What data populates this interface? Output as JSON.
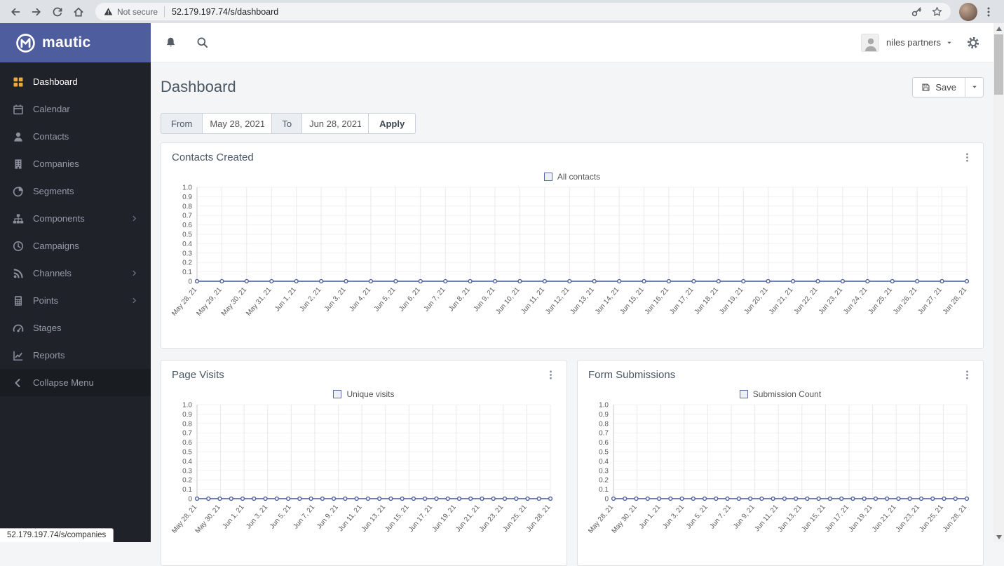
{
  "browser": {
    "security_label": "Not secure",
    "url": "52.179.197.74/s/dashboard",
    "status_bar_link": "52.179.197.74/s/companies"
  },
  "brand": {
    "name": "mautic"
  },
  "sidebar": {
    "items": [
      {
        "label": "Dashboard",
        "icon": "grid",
        "icon_color": "#eda93b",
        "active": true
      },
      {
        "label": "Calendar",
        "icon": "calendar"
      },
      {
        "label": "Contacts",
        "icon": "user"
      },
      {
        "label": "Companies",
        "icon": "building"
      },
      {
        "label": "Segments",
        "icon": "pie"
      },
      {
        "label": "Components",
        "icon": "sitemap",
        "expandable": true
      },
      {
        "label": "Campaigns",
        "icon": "clock"
      },
      {
        "label": "Channels",
        "icon": "rss",
        "expandable": true
      },
      {
        "label": "Points",
        "icon": "calculator",
        "expandable": true
      },
      {
        "label": "Stages",
        "icon": "gauge"
      },
      {
        "label": "Reports",
        "icon": "chart-line"
      }
    ],
    "collapse": {
      "label": "Collapse Menu",
      "icon": "chevron-left"
    }
  },
  "topbar": {
    "account_name": "niles partners"
  },
  "page": {
    "title": "Dashboard"
  },
  "actions": {
    "save_label": "Save"
  },
  "filter": {
    "from_label": "From",
    "from_value": "May 28, 2021",
    "to_label": "To",
    "to_value": "Jun 28, 2021",
    "apply_label": "Apply"
  },
  "colors": {
    "accent": "#4e5d9d",
    "line": "#6f80b2",
    "point": "#51629b"
  },
  "chart_data": [
    {
      "type": "line",
      "title": "Contacts Created",
      "legend_position": "top",
      "grid": true,
      "ylim": [
        0,
        1.0
      ],
      "y_ticks": [
        "1.0",
        "0.9",
        "0.8",
        "0.7",
        "0.6",
        "0.5",
        "0.4",
        "0.3",
        "0.2",
        "0.1",
        "0"
      ],
      "x_tick_labels": [
        "May 28, 21",
        "May 29, 21",
        "May 30, 21",
        "May 31, 21",
        "Jun 1, 21",
        "Jun 2, 21",
        "Jun 3, 21",
        "Jun 4, 21",
        "Jun 5, 21",
        "Jun 6, 21",
        "Jun 7, 21",
        "Jun 8, 21",
        "Jun 9, 21",
        "Jun 10, 21",
        "Jun 11, 21",
        "Jun 12, 21",
        "Jun 13, 21",
        "Jun 14, 21",
        "Jun 15, 21",
        "Jun 16, 21",
        "Jun 17, 21",
        "Jun 18, 21",
        "Jun 19, 21",
        "Jun 20, 21",
        "Jun 21, 21",
        "Jun 22, 21",
        "Jun 23, 21",
        "Jun 24, 21",
        "Jun 25, 21",
        "Jun 26, 21",
        "Jun 27, 21",
        "Jun 28, 21"
      ],
      "series": [
        {
          "name": "All contacts",
          "values": [
            0,
            0,
            0,
            0,
            0,
            0,
            0,
            0,
            0,
            0,
            0,
            0,
            0,
            0,
            0,
            0,
            0,
            0,
            0,
            0,
            0,
            0,
            0,
            0,
            0,
            0,
            0,
            0,
            0,
            0,
            0,
            0
          ]
        }
      ]
    },
    {
      "type": "line",
      "title": "Page Visits",
      "legend_position": "top",
      "grid": true,
      "ylim": [
        0,
        1.0
      ],
      "y_ticks": [
        "1.0",
        "0.9",
        "0.8",
        "0.7",
        "0.6",
        "0.5",
        "0.4",
        "0.3",
        "0.2",
        "0.1",
        "0"
      ],
      "x_tick_labels": [
        "May 28, 21",
        "May 30, 21",
        "Jun 1, 21",
        "Jun 3, 21",
        "Jun 5, 21",
        "Jun 7, 21",
        "Jun 9, 21",
        "Jun 11, 21",
        "Jun 13, 21",
        "Jun 15, 21",
        "Jun 17, 21",
        "Jun 19, 21",
        "Jun 21, 21",
        "Jun 23, 21",
        "Jun 25, 21",
        "Jun 28, 21"
      ],
      "series": [
        {
          "name": "Unique visits",
          "values": [
            0,
            0,
            0,
            0,
            0,
            0,
            0,
            0,
            0,
            0,
            0,
            0,
            0,
            0,
            0,
            0,
            0,
            0,
            0,
            0,
            0,
            0,
            0,
            0,
            0,
            0,
            0,
            0,
            0,
            0,
            0,
            0
          ]
        }
      ]
    },
    {
      "type": "line",
      "title": "Form Submissions",
      "legend_position": "top",
      "grid": true,
      "ylim": [
        0,
        1.0
      ],
      "y_ticks": [
        "1.0",
        "0.9",
        "0.8",
        "0.7",
        "0.6",
        "0.5",
        "0.4",
        "0.3",
        "0.2",
        "0.1",
        "0"
      ],
      "x_tick_labels": [
        "May 28, 21",
        "May 30, 21",
        "Jun 1, 21",
        "Jun 3, 21",
        "Jun 5, 21",
        "Jun 7, 21",
        "Jun 9, 21",
        "Jun 11, 21",
        "Jun 13, 21",
        "Jun 15, 21",
        "Jun 17, 21",
        "Jun 19, 21",
        "Jun 21, 21",
        "Jun 23, 21",
        "Jun 25, 21",
        "Jun 28, 21"
      ],
      "series": [
        {
          "name": "Submission Count",
          "values": [
            0,
            0,
            0,
            0,
            0,
            0,
            0,
            0,
            0,
            0,
            0,
            0,
            0,
            0,
            0,
            0,
            0,
            0,
            0,
            0,
            0,
            0,
            0,
            0,
            0,
            0,
            0,
            0,
            0,
            0,
            0,
            0
          ]
        }
      ]
    }
  ]
}
